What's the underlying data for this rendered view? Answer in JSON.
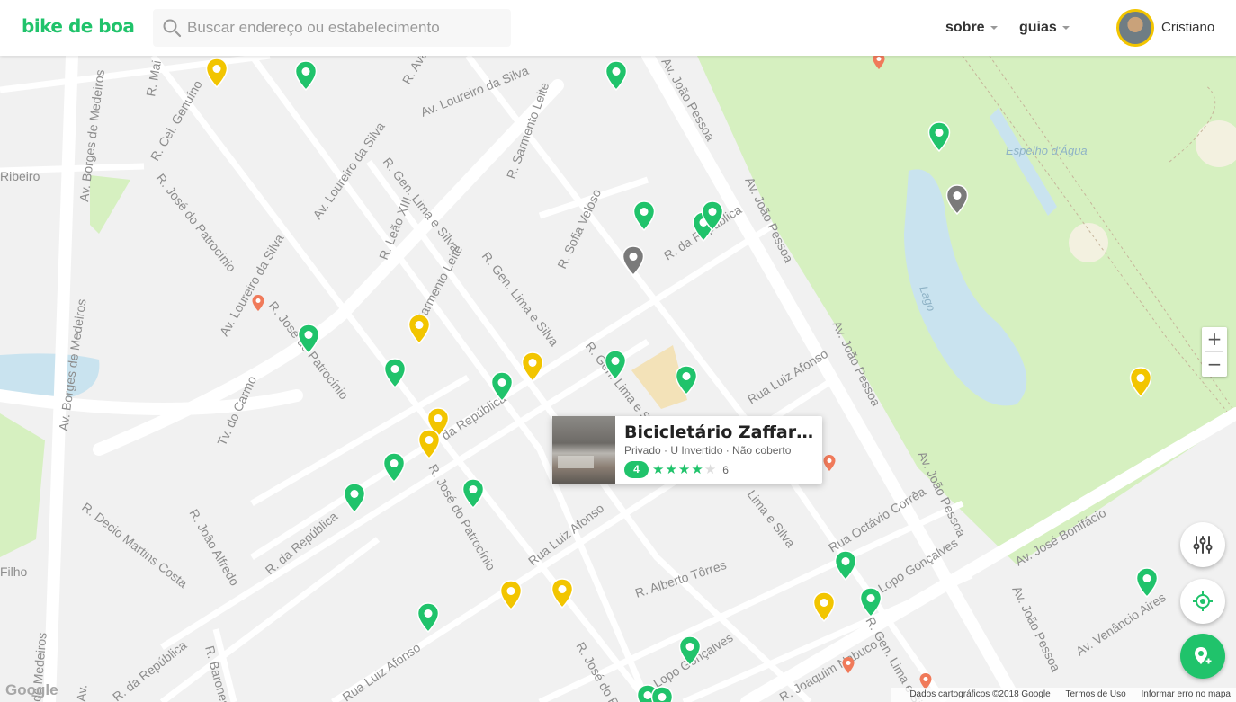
{
  "brand": {
    "logo": "bike de boa",
    "accent": "#20c36b"
  },
  "search": {
    "placeholder": "Buscar endereço ou estabelecimento"
  },
  "nav": {
    "sobre": "sobre",
    "guias": "guias"
  },
  "user": {
    "name": "Cristiano"
  },
  "popup": {
    "title": "Bicicletário Zaffari G...",
    "meta": "Privado · U Invertido · Não coberto",
    "rating": "4",
    "stars_filled": 4,
    "stars_total": 5,
    "reviews": "6"
  },
  "streets": {
    "s1": "R. Mai",
    "s2": "R. Aval",
    "s3": "Av. Loureiro da Silva",
    "s4": "Av. João Pessoa",
    "s5": "R. Cel. Genuíno",
    "s6": "Av. Borges de Medeiros",
    "s7": "R. Sarmento Leite",
    "s8": "Ribeiro",
    "s9": "R. Gen. Lima e Silva",
    "s10": "R. José do Patrocínio",
    "s11": "Av. Loureiro da Silva",
    "s12": "R. Leão XIII",
    "s13": "R. Sofia Veloso",
    "s14": "R. da República",
    "s15": "Av. João Pessoa",
    "s16": "Sarmento Leite",
    "s17": "R. Gen. Lima e Silva",
    "s18": "R. José do Patrocínio",
    "s19": "Av. Loureiro da Silva",
    "s20": "Av. Borges de Medeiros",
    "s21": "R. Gen. Lima e Silva",
    "s22": "Rua Luiz Afonso",
    "s23": "Av. João Pessoa",
    "s24": "da República",
    "s25": "Tv. do Carmo",
    "s26": "R. José do Patrocínio",
    "s27": "Lima e Silva",
    "s28": "Av. João Pessoa",
    "s29": "R. Décio Martins Costa",
    "s30": "R. João Alfredo",
    "s31": "R. da República",
    "s32": "Rua Luiz Afonso",
    "s33": "Rua Octávio Corrêa",
    "s34": "Av. José Bonifácio",
    "s35": "Filho",
    "s36": "R. Alberto Tôrres",
    "s37": "Lopo Gonçalves",
    "s38": "Av. João Pessoa",
    "s39": "Av. Venâncio Aires",
    "s40": "R. Gen. Lima e Si",
    "s41": "Rua Luiz Afonso",
    "s42": "R. Lopo Gonçalves",
    "s43": "R. José do Pat",
    "s44": "R. Joaquim Nabuco",
    "s45": "R. Baronesa",
    "s46": "de Medeiros",
    "s47": "Av.",
    "s48": "R. da República",
    "park1": "Espelho d'Água",
    "park2": "Lago"
  },
  "attribution": {
    "data": "Dados cartográficos ©2018 Google",
    "terms": "Termos de Uso",
    "report": "Informar erro no mapa",
    "google": "Google"
  },
  "colors": {
    "pin_green": "#20c36b",
    "pin_yellow": "#f2c500",
    "pin_gray": "#7a7a7a",
    "pin_orange": "#f07a5a",
    "park": "#d6f0c0",
    "water": "#c9e3ef"
  },
  "icons": {
    "search": "search-icon",
    "filter": "sliders-icon",
    "locate": "crosshair-icon",
    "add": "add-location-icon"
  }
}
